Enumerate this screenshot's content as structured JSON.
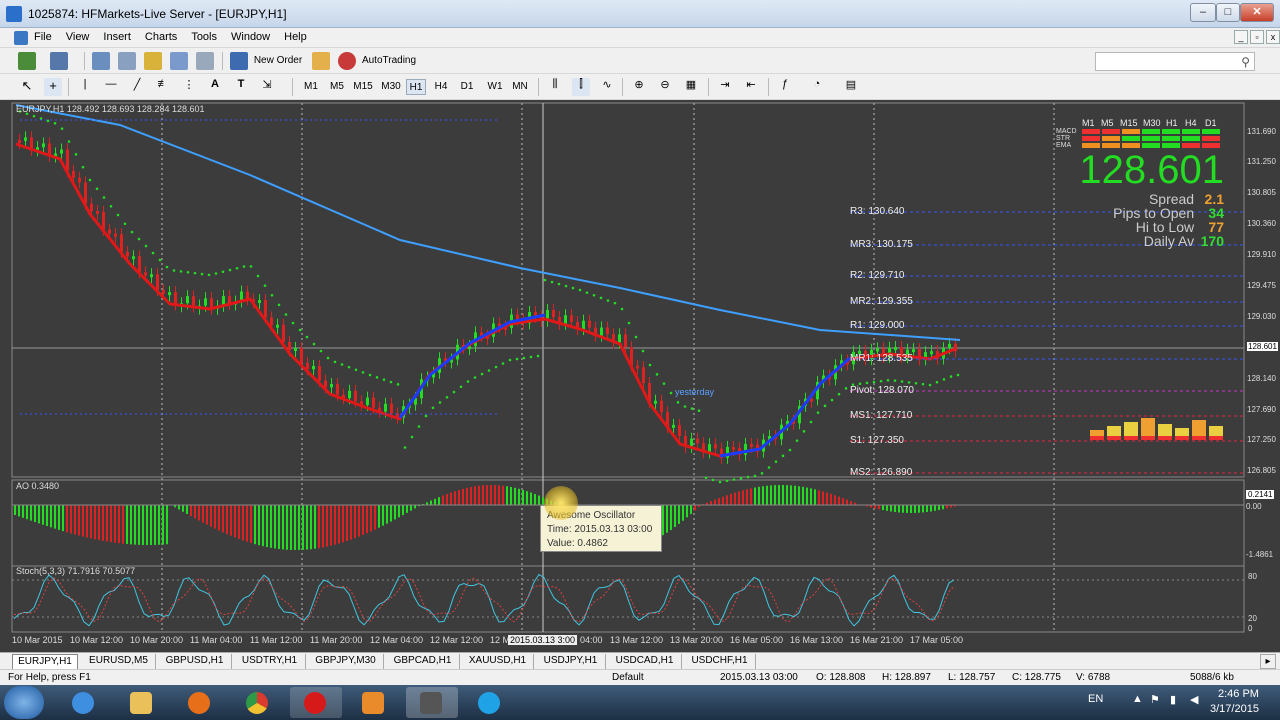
{
  "window": {
    "title": "1025874: HFMarkets-Live Server - [EURJPY,H1]"
  },
  "menu": [
    "File",
    "View",
    "Insert",
    "Charts",
    "Tools",
    "Window",
    "Help"
  ],
  "toolbar": {
    "new_order": "New Order",
    "autotrading": "AutoTrading"
  },
  "timeframes": [
    "M1",
    "M5",
    "M15",
    "M30",
    "H1",
    "H4",
    "D1",
    "W1",
    "MN"
  ],
  "chart": {
    "header": "EURJPY,H1  128.492 128.693 128.284 128.601",
    "price_scale": [
      "131.690",
      "131.250",
      "130.805",
      "130.360",
      "129.910",
      "129.475",
      "129.030",
      "128.601",
      "128.140",
      "127.690",
      "127.250",
      "126.805"
    ],
    "levels": [
      {
        "label": "R3: 130.640"
      },
      {
        "label": "MR3: 130.175"
      },
      {
        "label": "R2: 129.710"
      },
      {
        "label": "MR2: 129.355"
      },
      {
        "label": "R1: 129.000"
      },
      {
        "label": "MR1: 128.535"
      },
      {
        "label": "Pivot: 128.070"
      },
      {
        "label": "MS1: 127.710"
      },
      {
        "label": "S1: 127.350"
      },
      {
        "label": "MS2: 126.890"
      }
    ],
    "yesterday_label": "yesterday",
    "dashboard": {
      "timeframes": [
        "M1",
        "M5",
        "M15",
        "M30",
        "H1",
        "H4",
        "D1"
      ],
      "indicators": [
        "MACD",
        "STR",
        "EMA"
      ],
      "price": "128.601",
      "rows": [
        {
          "label": "Spread",
          "value": "2.1",
          "color": "#f0a030"
        },
        {
          "label": "Pips to Open",
          "value": "34",
          "color": "#33dd33"
        },
        {
          "label": "Hi to Low",
          "value": "77",
          "color": "#f0a030"
        },
        {
          "label": "Daily Av",
          "value": "170",
          "color": "#33dd33"
        }
      ]
    },
    "ao": {
      "header": "AO 0.3480",
      "scale": [
        "0.2141",
        "0.00",
        "-1.4861"
      ]
    },
    "tooltip": {
      "title": "Awesome Oscillator",
      "time": "Time: 2015.03.13 03:00",
      "value": "Value: 0.4862"
    },
    "stoch": {
      "header": "Stoch(5,3,3) 71.7916 70.5077",
      "scale": [
        "80",
        "20",
        "0"
      ]
    },
    "time_axis": [
      "10 Mar 2015",
      "10 Mar 12:00",
      "10 Mar 20:00",
      "11 Mar 04:00",
      "11 Mar 12:00",
      "11 Mar 20:00",
      "12 Mar 04:00",
      "12 Mar 12:00",
      "12 M",
      "04:00",
      "13 Mar 12:00",
      "13 Mar 20:00",
      "16 Mar 05:00",
      "16 Mar 13:00",
      "16 Mar 21:00",
      "17 Mar 05:00"
    ],
    "time_cursor": "2015.03.13 3:00"
  },
  "tabs": [
    "EURJPY,H1",
    "EURUSD,M5",
    "GBPUSD,H1",
    "USDTRY,H1",
    "GBPJPY,M30",
    "GBPCAD,H1",
    "XAUUSD,H1",
    "USDJPY,H1",
    "USDCAD,H1",
    "USDCHF,H1"
  ],
  "statusbar": {
    "help": "For Help, press F1",
    "profile": "Default",
    "time": "2015.03.13 03:00",
    "open": "O: 128.808",
    "high": "H: 128.897",
    "low": "L: 128.757",
    "close": "C: 128.775",
    "volume": "V: 6788",
    "traffic": "5088/6 kb"
  },
  "taskbar": {
    "lang": "EN",
    "time": "2:46 PM",
    "date": "3/17/2015"
  },
  "colors": {
    "chart_bg": "#3c3c3c",
    "bull": "#22dd22",
    "bear": "#dd2222",
    "ma_blue": "#3f9fff"
  }
}
